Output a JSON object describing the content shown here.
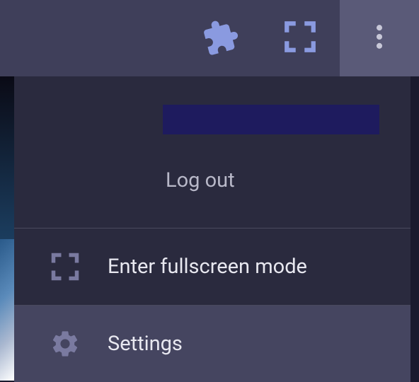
{
  "toolbar": {
    "icons": {
      "extensions": "extensions-icon",
      "fullscreen": "fullscreen-icon",
      "menu": "kebab-menu-icon"
    }
  },
  "dropdown": {
    "logout_label": "Log out",
    "items": [
      {
        "icon": "fullscreen-icon",
        "label": "Enter fullscreen mode"
      },
      {
        "icon": "gear-icon",
        "label": "Settings"
      }
    ]
  },
  "colors": {
    "accent": "#8a9ae0",
    "toolbar_bg": "#3f3f5a",
    "dropdown_bg": "#2a2a3e",
    "highlight": "#454560",
    "redacted": "#1e1b5e"
  }
}
